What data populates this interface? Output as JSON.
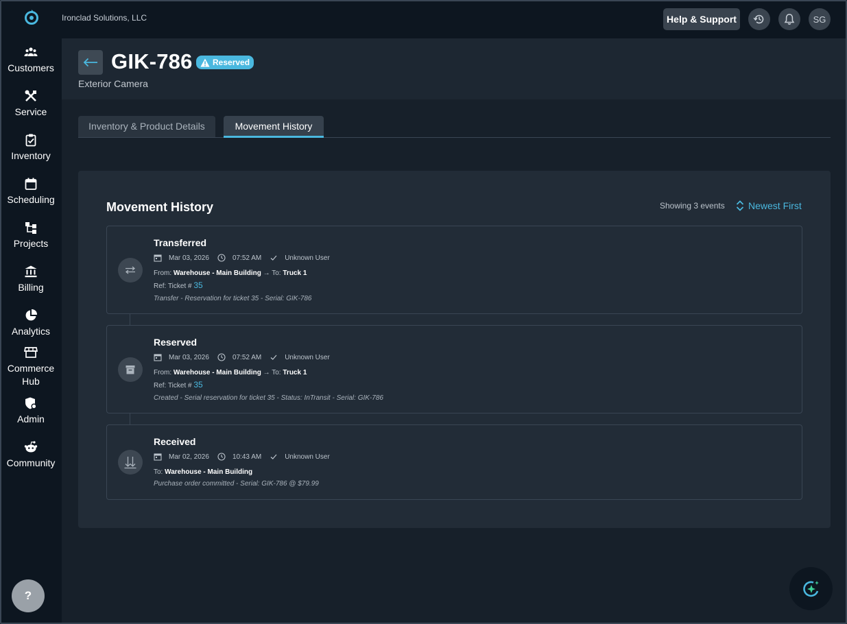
{
  "app": {
    "company": "Ironclad Solutions, LLC",
    "accent": "#4ab8df"
  },
  "topbar": {
    "support_label": "Help & Support",
    "history_icon": "history-icon",
    "notifications_icon": "bell-icon",
    "avatar_initials": "SG"
  },
  "sidebar": {
    "items": [
      {
        "label": "Customers",
        "icon": "users-icon"
      },
      {
        "label": "Service",
        "icon": "tools-icon"
      },
      {
        "label": "Inventory",
        "icon": "clipboard-check-icon"
      },
      {
        "label": "Scheduling",
        "icon": "calendar-icon"
      },
      {
        "label": "Projects",
        "icon": "hierarchy-icon"
      },
      {
        "label": "Billing",
        "icon": "bank-icon"
      },
      {
        "label": "Analytics",
        "icon": "pie-chart-icon"
      },
      {
        "label": "Commerce Hub",
        "icon": "storefront-icon"
      },
      {
        "label": "Admin",
        "icon": "shield-gear-icon"
      },
      {
        "label": "Community",
        "icon": "community-icon"
      }
    ],
    "help_label": "?"
  },
  "header": {
    "title": "GIK-786",
    "status_badge": "Reserved",
    "subtitle": "Exterior Camera"
  },
  "tabs": [
    {
      "label": "Inventory & Product Details",
      "active": false
    },
    {
      "label": "Movement History",
      "active": true
    }
  ],
  "history": {
    "title": "Movement History",
    "count_text": "Showing 3 events",
    "sort_label": "Newest First",
    "events": [
      {
        "type": "Transferred",
        "icon": "transfer-arrows-icon",
        "date": "Mar 03, 2026",
        "time": "07:52 AM",
        "user": "Unknown User",
        "from_label": "From:",
        "from": "Warehouse - Main Building",
        "to_label": "To:",
        "to": "Truck 1",
        "ref_label": "Ref: Ticket #",
        "ref_number": "35",
        "note": "Transfer - Reservation for ticket 35 - Serial: GIK-786"
      },
      {
        "type": "Reserved",
        "icon": "archive-box-icon",
        "date": "Mar 03, 2026",
        "time": "07:52 AM",
        "user": "Unknown User",
        "from_label": "From:",
        "from": "Warehouse - Main Building",
        "to_label": "To:",
        "to": "Truck 1",
        "ref_label": "Ref: Ticket #",
        "ref_number": "35",
        "note": "Created - Serial reservation for ticket 35 - Status: InTransit - Serial: GIK-786"
      },
      {
        "type": "Received",
        "icon": "receive-arrows-icon",
        "date": "Mar 02, 2026",
        "time": "10:43 AM",
        "user": "Unknown User",
        "to_label": "To:",
        "to": "Warehouse - Main Building",
        "note": "Purchase order committed - Serial: GIK-786 @ $79.99"
      }
    ]
  }
}
